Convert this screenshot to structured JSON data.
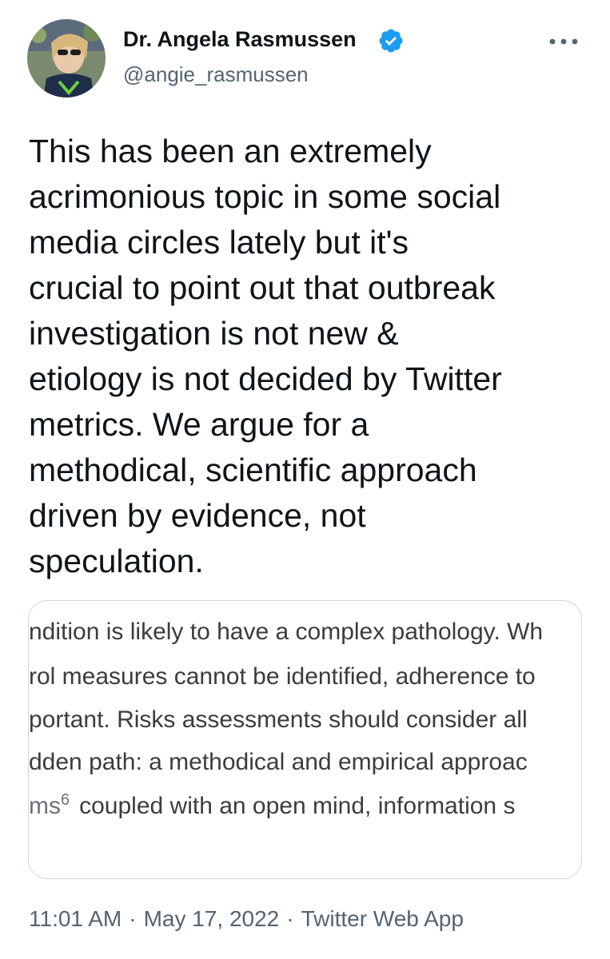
{
  "author": {
    "display_name": "Dr. Angela Rasmussen",
    "handle": "@angie_rasmussen",
    "verified_color": "#1d9bf0"
  },
  "icons": {
    "verified": "verified-badge-icon",
    "more": "more-options-icon",
    "avatar": "profile-avatar"
  },
  "tweet": {
    "text_lines": [
      "This has been an extremely",
      "acrimonious topic in some social",
      "media circles lately but it's",
      "crucial to point out that outbreak",
      "investigation is not new &",
      "etiology is not decided by Twitter",
      "metrics. We argue for a",
      "methodical, scientific approach",
      "driven by evidence, not",
      "speculation."
    ]
  },
  "media": {
    "line0": "ndition is likely to have a complex pathology. Wh",
    "line1": "rol measures cannot be identified, adherence to",
    "line2": "portant. Risks assessments should consider all",
    "line3": "dden path: a methodical and empirical approac",
    "line4_a": "ms",
    "line4_sup": "6",
    "line4_b": "coupled with an open mind, information s"
  },
  "meta": {
    "time": "11:01 AM",
    "date": "May 17, 2022",
    "source": "Twitter Web App",
    "separator": "·"
  }
}
